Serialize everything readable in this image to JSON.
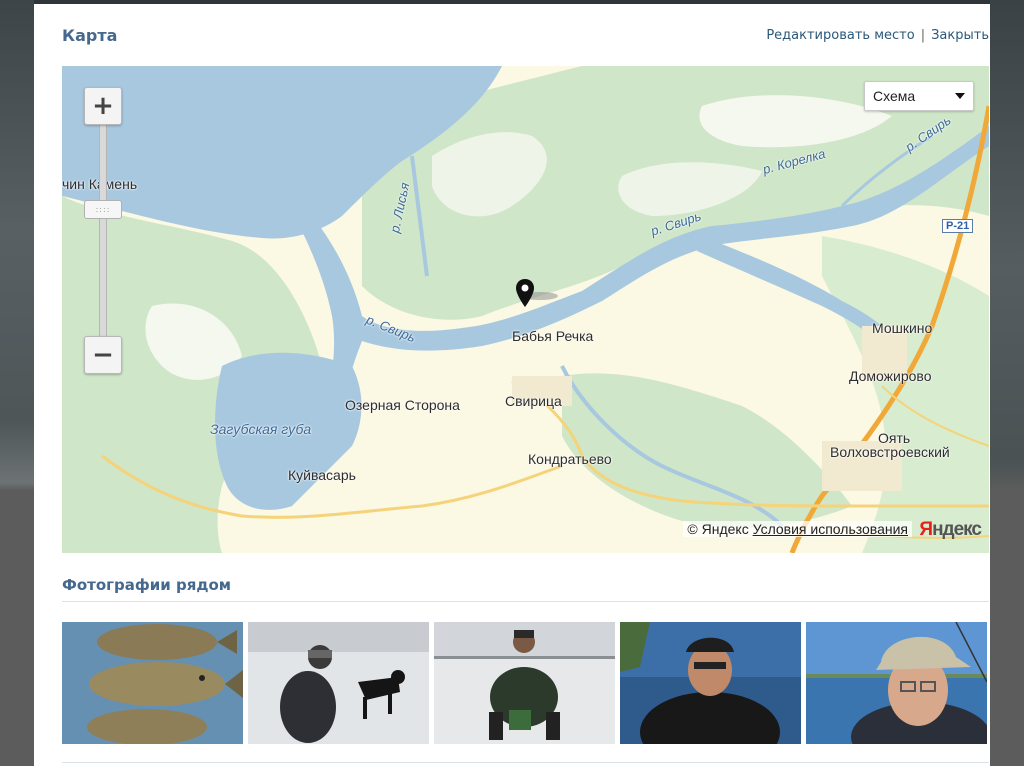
{
  "dialog": {
    "title": "Карта",
    "edit_link": "Редактировать место",
    "separator": "|",
    "close_link": "Закрыть"
  },
  "map": {
    "type_selector": {
      "value": "Схема"
    },
    "zoom": {
      "plus": "+",
      "minus": "−"
    },
    "labels": {
      "kamen": "чин Камень",
      "lisya": "р. Лисья",
      "svir_left": "р. Свирь",
      "svir_right": "р. Свирь",
      "svir_far": "р. Свирь",
      "korelka": "р. Корелка",
      "babya_rechka": "Бабья Речка",
      "zagubskaya": "Загубская губа",
      "ozernaya": "Озерная Сторона",
      "svirica": "Свирица",
      "kuivasar": "Куйвасарь",
      "kondratyevo": "Кондратьево",
      "moshkino": "Мошкино",
      "domozhirovo": "Доможирово",
      "oyat": "Оять",
      "volkhovstroevsky": "Волховстроевский",
      "road": "Р-21"
    },
    "copyright": "© Яндекс",
    "terms_link": "Условия использования",
    "logo": {
      "first": "Я",
      "rest": "ндекс"
    }
  },
  "photos": {
    "title": "Фотографии рядом",
    "items": [
      {
        "subject": "fish-photo"
      },
      {
        "subject": "ice-fishing-with-dog-photo"
      },
      {
        "subject": "ice-fishing-sitting-photo"
      },
      {
        "subject": "man-in-cap-boat-photo"
      },
      {
        "subject": "man-in-hat-glasses-photo"
      }
    ]
  },
  "colors": {
    "accent": "#45688e",
    "link": "#2b587a",
    "water": "#a8c8e0",
    "land": "#fbf8e4",
    "forest": "#cfe6c8",
    "road_major": "#f0a838"
  }
}
